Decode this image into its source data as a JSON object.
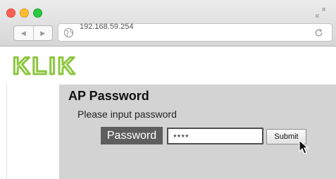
{
  "browser": {
    "url": "192.168.59.254",
    "nav": {
      "back_icon": "◀",
      "forward_icon": "▶"
    }
  },
  "logo": {
    "text": "KLIK",
    "color": "#8dc63f"
  },
  "form": {
    "title": "AP Password",
    "instruction": "Please input password",
    "password_label": "Password",
    "password_value": "****",
    "submit_label": "Submit"
  },
  "colors": {
    "panel_background": "#d3d3d3",
    "label_background": "#5e5e5e",
    "logo_green": "#8dc63f"
  }
}
